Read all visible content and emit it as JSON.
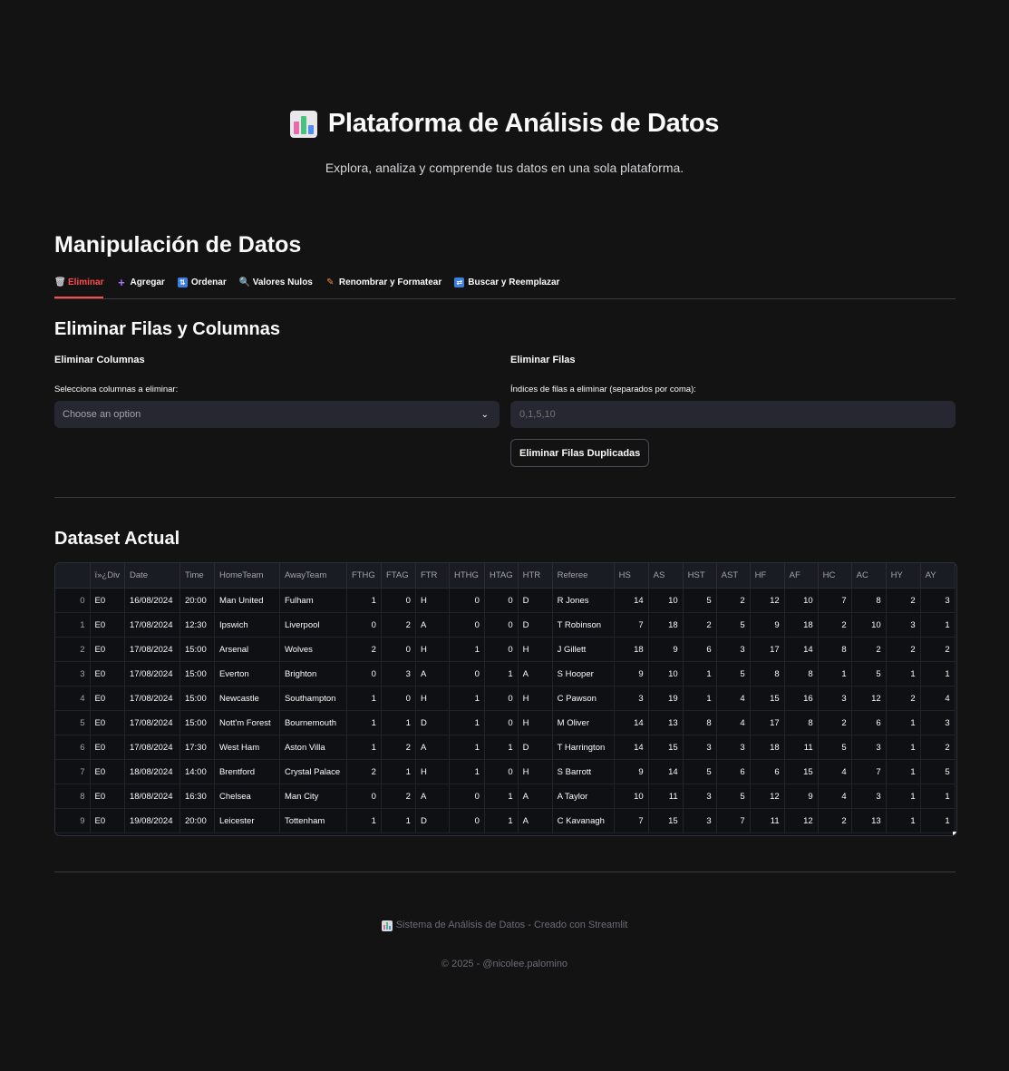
{
  "header": {
    "title": "Plataforma de Análisis de Datos",
    "subtitle": "Explora, analiza y comprende tus datos en una sola plataforma."
  },
  "section": {
    "title": "Manipulación de Datos",
    "tabs": [
      {
        "icon": "trash-icon",
        "label": "Eliminar",
        "active": true
      },
      {
        "icon": "plus-icon",
        "label": "Agregar",
        "active": false
      },
      {
        "icon": "sort-icon",
        "label": "Ordenar",
        "active": false
      },
      {
        "icon": "magnifier-icon",
        "label": "Valores Nulos",
        "active": false
      },
      {
        "icon": "pencil-icon",
        "label": "Renombrar y Formatear",
        "active": false
      },
      {
        "icon": "replace-icon",
        "label": "Buscar y Reemplazar",
        "active": false
      }
    ]
  },
  "delete_panel": {
    "title": "Eliminar Filas y Columnas",
    "columns": {
      "heading": "Eliminar Columnas",
      "label": "Selecciona columnas a eliminar:",
      "placeholder": "Choose an option"
    },
    "rows": {
      "heading": "Eliminar Filas",
      "label": "Índices de filas a eliminar (separados por coma):",
      "placeholder": "0,1,5,10",
      "dup_button": "Eliminar Filas Duplicadas"
    }
  },
  "dataset": {
    "title": "Dataset Actual",
    "columns": [
      "ï»¿Div",
      "Date",
      "Time",
      "HomeTeam",
      "AwayTeam",
      "FTHG",
      "FTAG",
      "FTR",
      "HTHG",
      "HTAG",
      "HTR",
      "Referee",
      "HS",
      "AS",
      "HST",
      "AST",
      "HF",
      "AF",
      "HC",
      "AC",
      "HY",
      "AY"
    ],
    "rows": [
      [
        "0",
        "E0",
        "16/08/2024",
        "20:00",
        "Man United",
        "Fulham",
        "1",
        "0",
        "H",
        "0",
        "0",
        "D",
        "R Jones",
        "14",
        "10",
        "5",
        "2",
        "12",
        "10",
        "7",
        "8",
        "2",
        "3"
      ],
      [
        "1",
        "E0",
        "17/08/2024",
        "12:30",
        "Ipswich",
        "Liverpool",
        "0",
        "2",
        "A",
        "0",
        "0",
        "D",
        "T Robinson",
        "7",
        "18",
        "2",
        "5",
        "9",
        "18",
        "2",
        "10",
        "3",
        "1"
      ],
      [
        "2",
        "E0",
        "17/08/2024",
        "15:00",
        "Arsenal",
        "Wolves",
        "2",
        "0",
        "H",
        "1",
        "0",
        "H",
        "J Gillett",
        "18",
        "9",
        "6",
        "3",
        "17",
        "14",
        "8",
        "2",
        "2",
        "2"
      ],
      [
        "3",
        "E0",
        "17/08/2024",
        "15:00",
        "Everton",
        "Brighton",
        "0",
        "3",
        "A",
        "0",
        "1",
        "A",
        "S Hooper",
        "9",
        "10",
        "1",
        "5",
        "8",
        "8",
        "1",
        "5",
        "1",
        "1"
      ],
      [
        "4",
        "E0",
        "17/08/2024",
        "15:00",
        "Newcastle",
        "Southampton",
        "1",
        "0",
        "H",
        "1",
        "0",
        "H",
        "C Pawson",
        "3",
        "19",
        "1",
        "4",
        "15",
        "16",
        "3",
        "12",
        "2",
        "4"
      ],
      [
        "5",
        "E0",
        "17/08/2024",
        "15:00",
        "Nott'm Forest",
        "Bournemouth",
        "1",
        "1",
        "D",
        "1",
        "0",
        "H",
        "M Oliver",
        "14",
        "13",
        "8",
        "4",
        "17",
        "8",
        "2",
        "6",
        "1",
        "3"
      ],
      [
        "6",
        "E0",
        "17/08/2024",
        "17:30",
        "West Ham",
        "Aston Villa",
        "1",
        "2",
        "A",
        "1",
        "1",
        "D",
        "T Harrington",
        "14",
        "15",
        "3",
        "3",
        "18",
        "11",
        "5",
        "3",
        "1",
        "2"
      ],
      [
        "7",
        "E0",
        "18/08/2024",
        "14:00",
        "Brentford",
        "Crystal Palace",
        "2",
        "1",
        "H",
        "1",
        "0",
        "H",
        "S Barrott",
        "9",
        "14",
        "5",
        "6",
        "6",
        "15",
        "4",
        "7",
        "1",
        "5"
      ],
      [
        "8",
        "E0",
        "18/08/2024",
        "16:30",
        "Chelsea",
        "Man City",
        "0",
        "2",
        "A",
        "0",
        "1",
        "A",
        "A Taylor",
        "10",
        "11",
        "3",
        "5",
        "12",
        "9",
        "4",
        "3",
        "1",
        "1"
      ],
      [
        "9",
        "E0",
        "19/08/2024",
        "20:00",
        "Leicester",
        "Tottenham",
        "1",
        "1",
        "D",
        "0",
        "1",
        "A",
        "C Kavanagh",
        "7",
        "15",
        "3",
        "7",
        "11",
        "12",
        "2",
        "13",
        "1",
        "1"
      ]
    ]
  },
  "footer": {
    "line1": "Sistema de Análisis de Datos - Creado con Streamlit",
    "line2": "© 2025 - @nicolee.palomino"
  },
  "colors": {
    "accent": "#ff4b4b",
    "background": "#131314",
    "input_bg": "#262730"
  }
}
